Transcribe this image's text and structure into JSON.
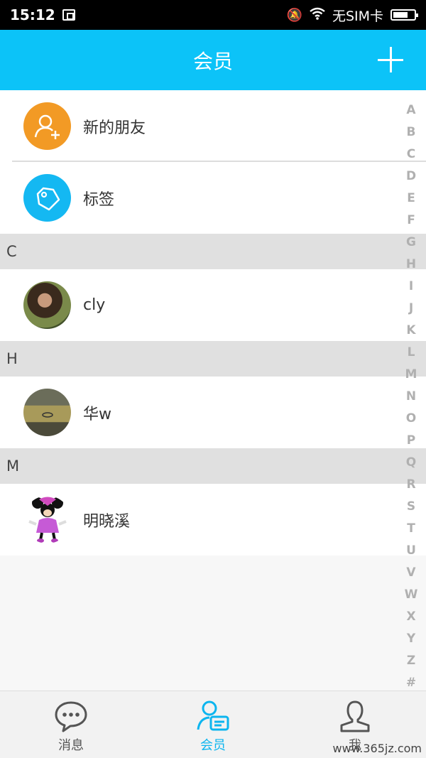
{
  "status_bar": {
    "time": "15:12",
    "carrier": "无SIM卡",
    "battery_level": 0.7
  },
  "header": {
    "title": "会员"
  },
  "fixed_items": [
    {
      "label": "新的朋友",
      "icon": "add-friend-icon",
      "color": "#f29a25"
    },
    {
      "label": "标签",
      "icon": "tag-icon",
      "color": "#14b8f2"
    }
  ],
  "sections": [
    {
      "letter": "C",
      "contacts": [
        {
          "name": "cly"
        }
      ]
    },
    {
      "letter": "H",
      "contacts": [
        {
          "name": "华w"
        }
      ]
    },
    {
      "letter": "M",
      "contacts": [
        {
          "name": "明晓溪"
        }
      ]
    }
  ],
  "index_letters": [
    "A",
    "B",
    "C",
    "D",
    "E",
    "F",
    "G",
    "H",
    "I",
    "J",
    "K",
    "L",
    "M",
    "N",
    "O",
    "P",
    "Q",
    "R",
    "S",
    "T",
    "U",
    "V",
    "W",
    "X",
    "Y",
    "Z",
    "#"
  ],
  "tabs": [
    {
      "label": "消息",
      "icon": "chat-bubble-icon"
    },
    {
      "label": "会员",
      "icon": "member-card-icon"
    },
    {
      "label": "我",
      "icon": "person-icon"
    }
  ],
  "watermark": "www.365jz.com",
  "colors": {
    "accent": "#0cc3f8",
    "section_bg": "#e0e0e0"
  }
}
